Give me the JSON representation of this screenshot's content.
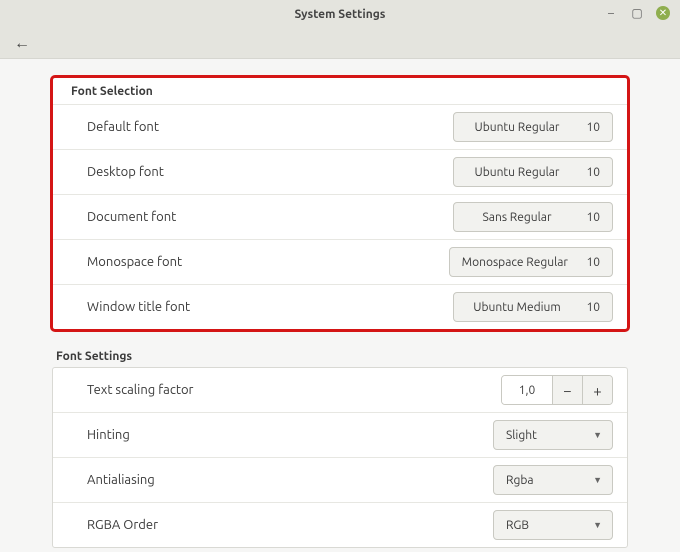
{
  "window": {
    "title": "System Settings"
  },
  "fontSelection": {
    "label": "Font Selection",
    "rows": [
      {
        "label": "Default font",
        "font": "Ubuntu Regular",
        "size": "10"
      },
      {
        "label": "Desktop font",
        "font": "Ubuntu Regular",
        "size": "10"
      },
      {
        "label": "Document font",
        "font": "Sans Regular",
        "size": "10"
      },
      {
        "label": "Monospace font",
        "font": "Monospace Regular",
        "size": "10"
      },
      {
        "label": "Window title font",
        "font": "Ubuntu Medium",
        "size": "10"
      }
    ]
  },
  "fontSettings": {
    "label": "Font Settings",
    "scaling": {
      "label": "Text scaling factor",
      "value": "1,0"
    },
    "hinting": {
      "label": "Hinting",
      "value": "Slight"
    },
    "antialias": {
      "label": "Antialiasing",
      "value": "Rgba"
    },
    "rgbaOrder": {
      "label": "RGBA Order",
      "value": "RGB"
    }
  }
}
